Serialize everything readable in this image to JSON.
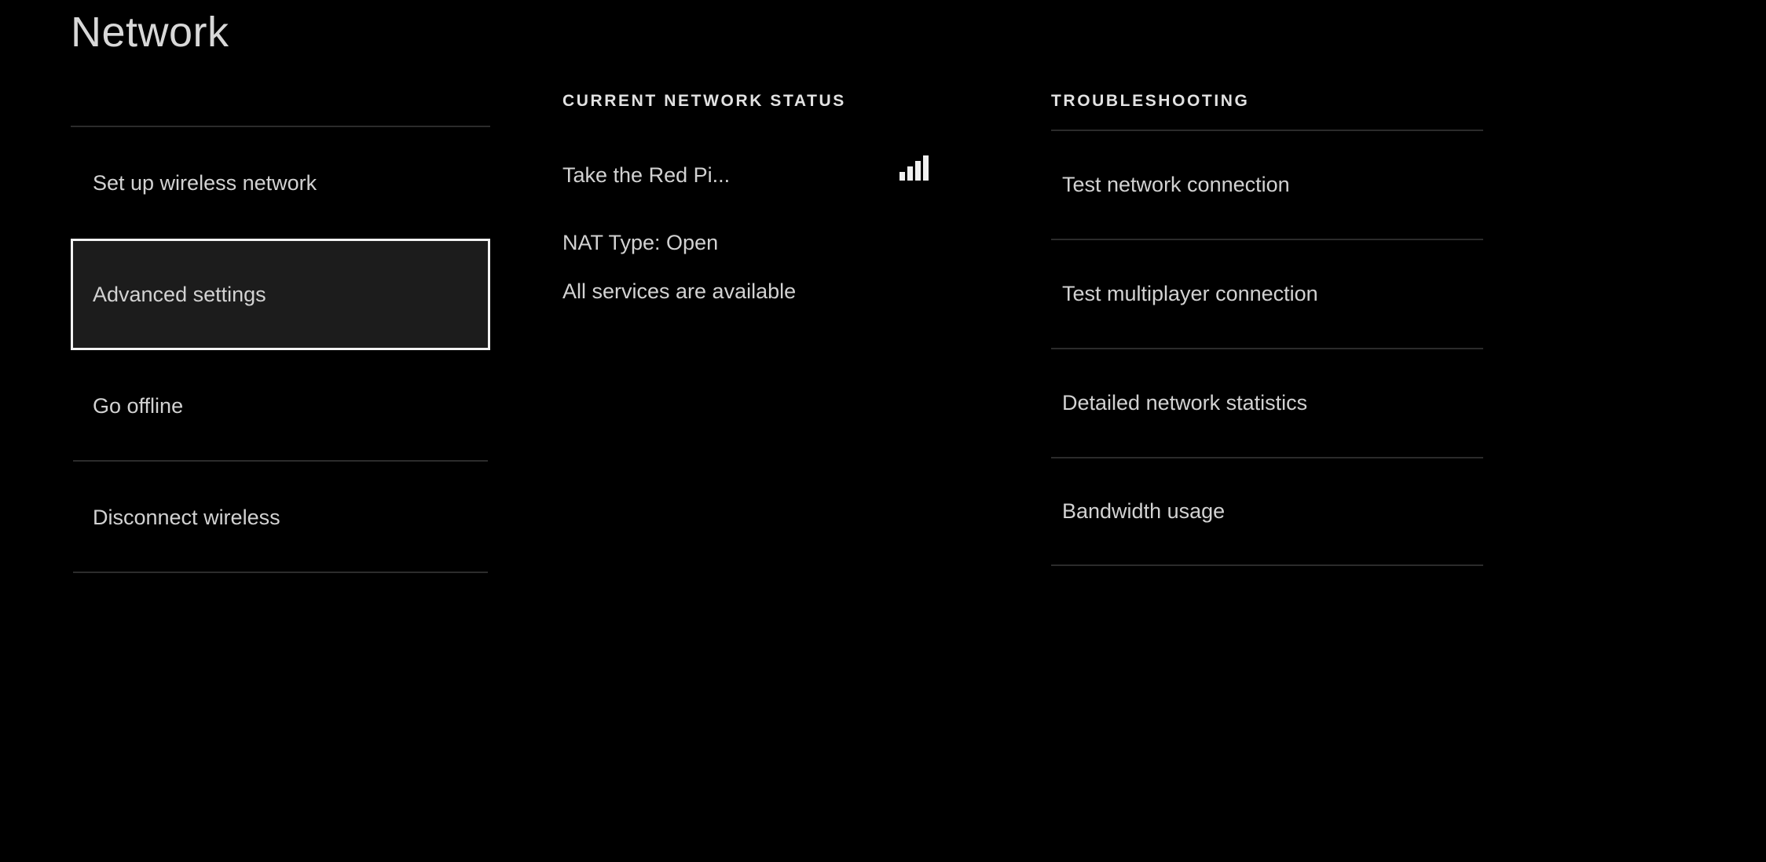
{
  "page": {
    "title": "Network",
    "background_color": "#000000",
    "text_color": "#d2d2d2",
    "accent_color": "#f2f2f2"
  },
  "sidebar": {
    "items": [
      {
        "label": "Set up wireless network",
        "selected": false,
        "rule_below": false
      },
      {
        "label": "Advanced settings",
        "selected": true,
        "rule_below": false
      },
      {
        "label": "Go offline",
        "selected": false,
        "rule_below": true
      },
      {
        "label": "Disconnect wireless",
        "selected": false,
        "rule_below": true
      }
    ]
  },
  "status": {
    "heading": "CURRENT NETWORK STATUS",
    "network_name": "Take the Red Pi...",
    "signal_icon": "signal-bars-icon",
    "signal_bars": 4,
    "nat_type": "NAT Type: Open",
    "services": "All services are available"
  },
  "troubleshooting": {
    "heading": "TROUBLESHOOTING",
    "items": [
      {
        "label": "Test network connection"
      },
      {
        "label": "Test multiplayer connection"
      },
      {
        "label": "Detailed network statistics"
      },
      {
        "label": "Bandwidth usage"
      }
    ]
  }
}
